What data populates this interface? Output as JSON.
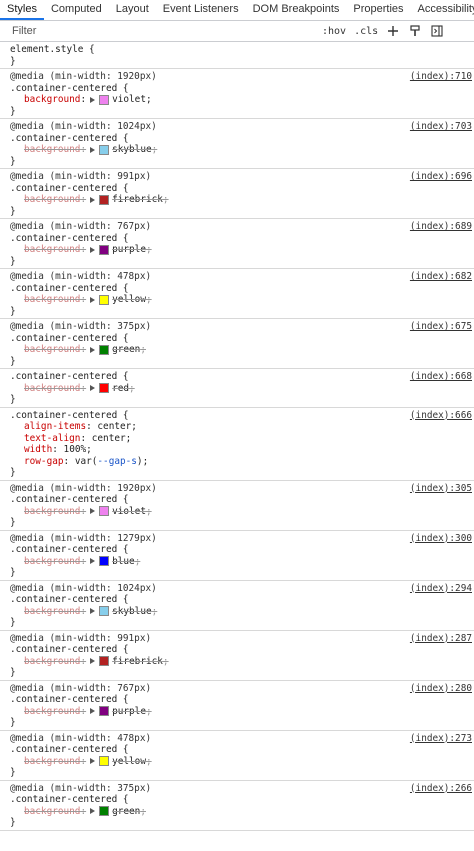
{
  "tabs": [
    "Styles",
    "Computed",
    "Layout",
    "Event Listeners",
    "DOM Breakpoints",
    "Properties",
    "Accessibility"
  ],
  "filter": {
    "placeholder": "Filter",
    "hov": ":hov",
    "cls": ".cls"
  },
  "icons": {
    "add": "plus-icon",
    "paint": "paint-brush-icon",
    "sidebar": "toggle-sidebar-icon"
  },
  "element_style": {
    "selector": "element.style {",
    "close": "}"
  },
  "rules": [
    {
      "media": "@media (min-width: 1920px)",
      "selector": ".container-centered {",
      "source": "(index):710",
      "props": [
        {
          "name": "background",
          "value": "violet",
          "color": "#ee82ee",
          "struck": false
        }
      ]
    },
    {
      "media": "@media (min-width: 1024px)",
      "selector": ".container-centered {",
      "source": "(index):703",
      "props": [
        {
          "name": "background",
          "value": "skyblue",
          "color": "#87ceeb",
          "struck": true
        }
      ]
    },
    {
      "media": "@media (min-width: 991px)",
      "selector": ".container-centered {",
      "source": "(index):696",
      "props": [
        {
          "name": "background",
          "value": "firebrick",
          "color": "#b22222",
          "struck": true
        }
      ]
    },
    {
      "media": "@media (min-width: 767px)",
      "selector": ".container-centered {",
      "source": "(index):689",
      "props": [
        {
          "name": "background",
          "value": "purple",
          "color": "#800080",
          "struck": true
        }
      ]
    },
    {
      "media": "@media (min-width: 478px)",
      "selector": ".container-centered {",
      "source": "(index):682",
      "props": [
        {
          "name": "background",
          "value": "yellow",
          "color": "#ffff00",
          "struck": true
        }
      ]
    },
    {
      "media": "@media (min-width: 375px)",
      "selector": ".container-centered {",
      "source": "(index):675",
      "props": [
        {
          "name": "background",
          "value": "green",
          "color": "#008000",
          "struck": true
        }
      ]
    },
    {
      "media": "",
      "selector": ".container-centered {",
      "source": "(index):668",
      "props": [
        {
          "name": "background",
          "value": "red",
          "color": "#ff0000",
          "struck": true
        }
      ]
    },
    {
      "media": "",
      "selector": ".container-centered {",
      "source": "(index):666",
      "props": [
        {
          "name": "align-items",
          "value": "center",
          "struck": false
        },
        {
          "name": "text-align",
          "value": "center",
          "struck": false
        },
        {
          "name": "width",
          "value": "100%",
          "struck": false
        },
        {
          "name": "row-gap",
          "value": "var(--gap-s)",
          "struck": false
        }
      ]
    },
    {
      "media": "@media (min-width: 1920px)",
      "selector": ".container-centered {",
      "source": "(index):305",
      "props": [
        {
          "name": "background",
          "value": "violet",
          "color": "#ee82ee",
          "struck": true
        }
      ]
    },
    {
      "media": "@media (min-width: 1279px)",
      "selector": ".container-centered {",
      "source": "(index):300",
      "props": [
        {
          "name": "background",
          "value": "blue",
          "color": "#0000ff",
          "struck": true
        }
      ]
    },
    {
      "media": "@media (min-width: 1024px)",
      "selector": ".container-centered {",
      "source": "(index):294",
      "props": [
        {
          "name": "background",
          "value": "skyblue",
          "color": "#87ceeb",
          "struck": true
        }
      ]
    },
    {
      "media": "@media (min-width: 991px)",
      "selector": ".container-centered {",
      "source": "(index):287",
      "props": [
        {
          "name": "background",
          "value": "firebrick",
          "color": "#b22222",
          "struck": true
        }
      ]
    },
    {
      "media": "@media (min-width: 767px)",
      "selector": ".container-centered {",
      "source": "(index):280",
      "props": [
        {
          "name": "background",
          "value": "purple",
          "color": "#800080",
          "struck": true
        }
      ]
    },
    {
      "media": "@media (min-width: 478px)",
      "selector": ".container-centered {",
      "source": "(index):273",
      "props": [
        {
          "name": "background",
          "value": "yellow",
          "color": "#ffff00",
          "struck": true
        }
      ]
    },
    {
      "media": "@media (min-width: 375px)",
      "selector": ".container-centered {",
      "source": "(index):266",
      "props": [
        {
          "name": "background",
          "value": "green",
          "color": "#008000",
          "struck": true
        }
      ]
    }
  ]
}
